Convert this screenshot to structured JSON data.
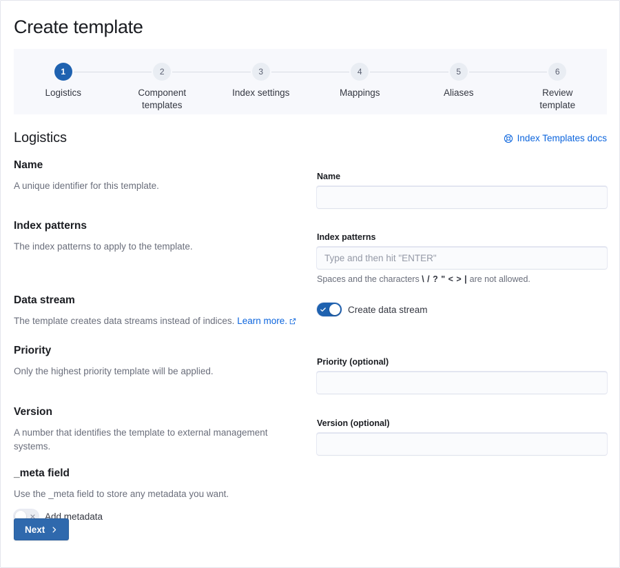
{
  "header": {
    "title": "Create template"
  },
  "stepper": {
    "active_index": 0,
    "active_color": "#1f62b0",
    "steps": [
      {
        "number": "1",
        "label": "Logistics"
      },
      {
        "number": "2",
        "label": "Component templates"
      },
      {
        "number": "3",
        "label": "Index settings"
      },
      {
        "number": "4",
        "label": "Mappings"
      },
      {
        "number": "5",
        "label": "Aliases"
      },
      {
        "number": "6",
        "label": "Review template"
      }
    ]
  },
  "section": {
    "title": "Logistics",
    "docs_link": "Index Templates docs"
  },
  "fields": {
    "name": {
      "title": "Name",
      "description": "A unique identifier for this template.",
      "input_label": "Name",
      "value": "",
      "placeholder": ""
    },
    "index_patterns": {
      "title": "Index patterns",
      "description": "The index patterns to apply to the template.",
      "input_label": "Index patterns",
      "value": "",
      "placeholder": "Type and then hit \"ENTER\"",
      "help_prefix": "Spaces and the characters ",
      "help_chars": "\\ / ? \" < > |",
      "help_suffix": " are not allowed."
    },
    "data_stream": {
      "title": "Data stream",
      "description": "The template creates data streams instead of indices.",
      "learn_more": "Learn more.",
      "switch_label": "Create data stream",
      "switch_state": "on"
    },
    "priority": {
      "title": "Priority",
      "description": "Only the highest priority template will be applied.",
      "input_label": "Priority (optional)",
      "value": "",
      "placeholder": ""
    },
    "version": {
      "title": "Version",
      "description": "A number that identifies the template to external management systems.",
      "input_label": "Version (optional)",
      "value": "",
      "placeholder": ""
    },
    "meta_field": {
      "title": "_meta field",
      "description": "Use the _meta field to store any metadata you want.",
      "switch_label": "Add metadata",
      "switch_state": "off"
    }
  },
  "footer": {
    "next_label": "Next"
  }
}
